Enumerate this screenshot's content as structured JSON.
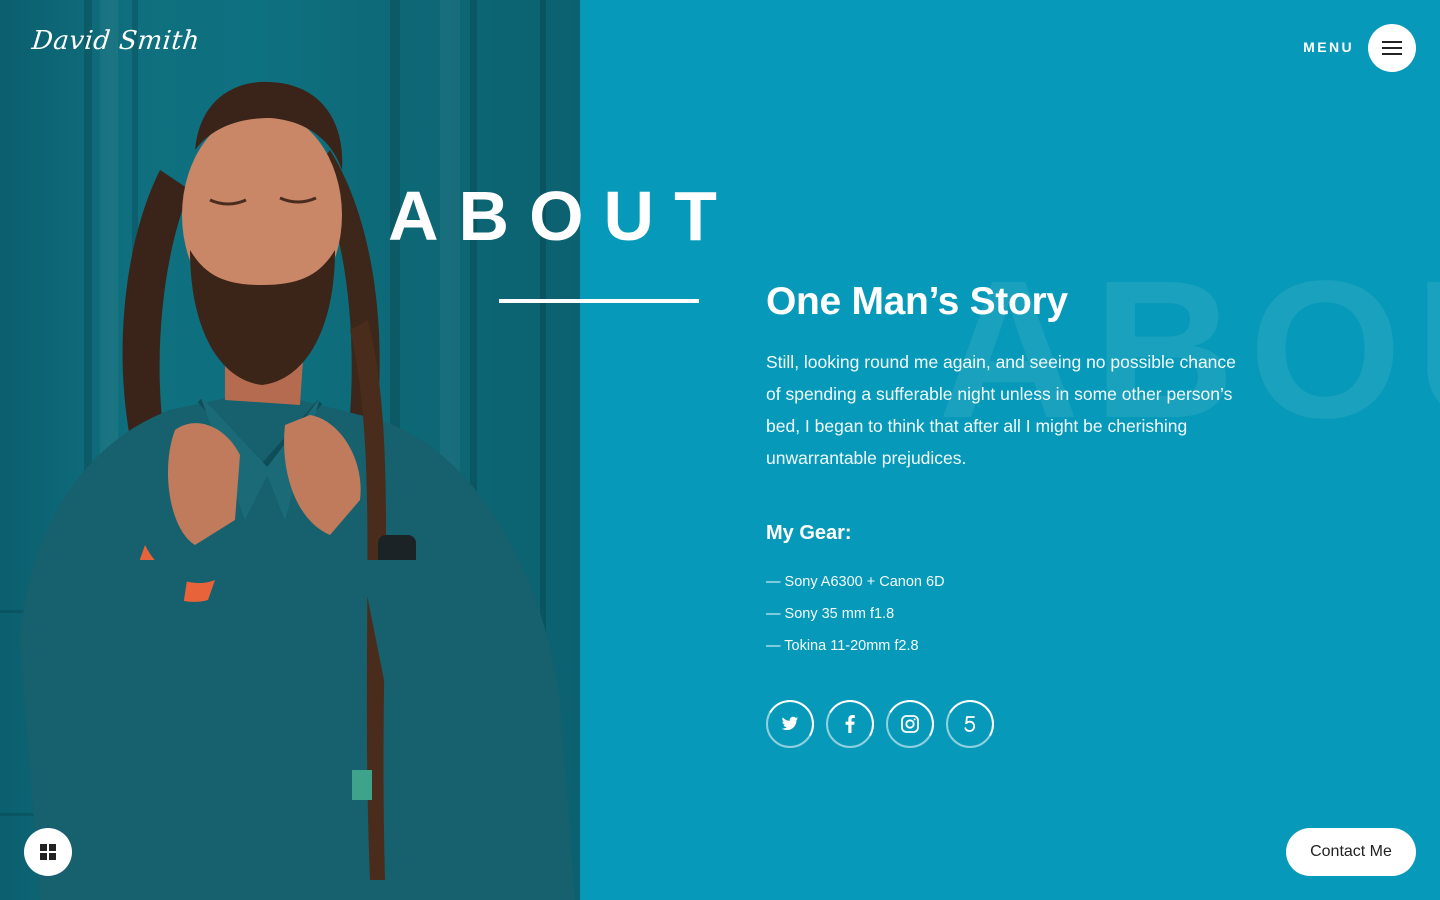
{
  "brand": {
    "name": "David Smith"
  },
  "header": {
    "menu_label": "MENU",
    "menu_icon": "hamburger-icon"
  },
  "hero": {
    "heading": "ABOUT",
    "watermark": "ABOUT",
    "photo": "portrait-photo"
  },
  "story": {
    "title": "One Man’s Story",
    "text": "Still, looking round me again, and seeing no possible chance of spending a sufferable night unless in some other person’s bed, I began to think that after all I might be cherishing unwarrantable prejudices."
  },
  "gear": {
    "title": "My Gear:",
    "items": [
      "— Sony A6300 + Canon 6D",
      "— Sony 35 mm f1.8",
      "— Tokina 11-20mm f2.8"
    ]
  },
  "socials": [
    {
      "icon": "twitter-icon"
    },
    {
      "icon": "facebook-icon"
    },
    {
      "icon": "instagram-icon"
    },
    {
      "icon": "500px-icon"
    }
  ],
  "footer": {
    "grid_icon": "grid-icon",
    "contact_label": "Contact Me"
  },
  "colors": {
    "accent": "#0799b9",
    "text": "#ffffff",
    "button_text": "#222222"
  }
}
